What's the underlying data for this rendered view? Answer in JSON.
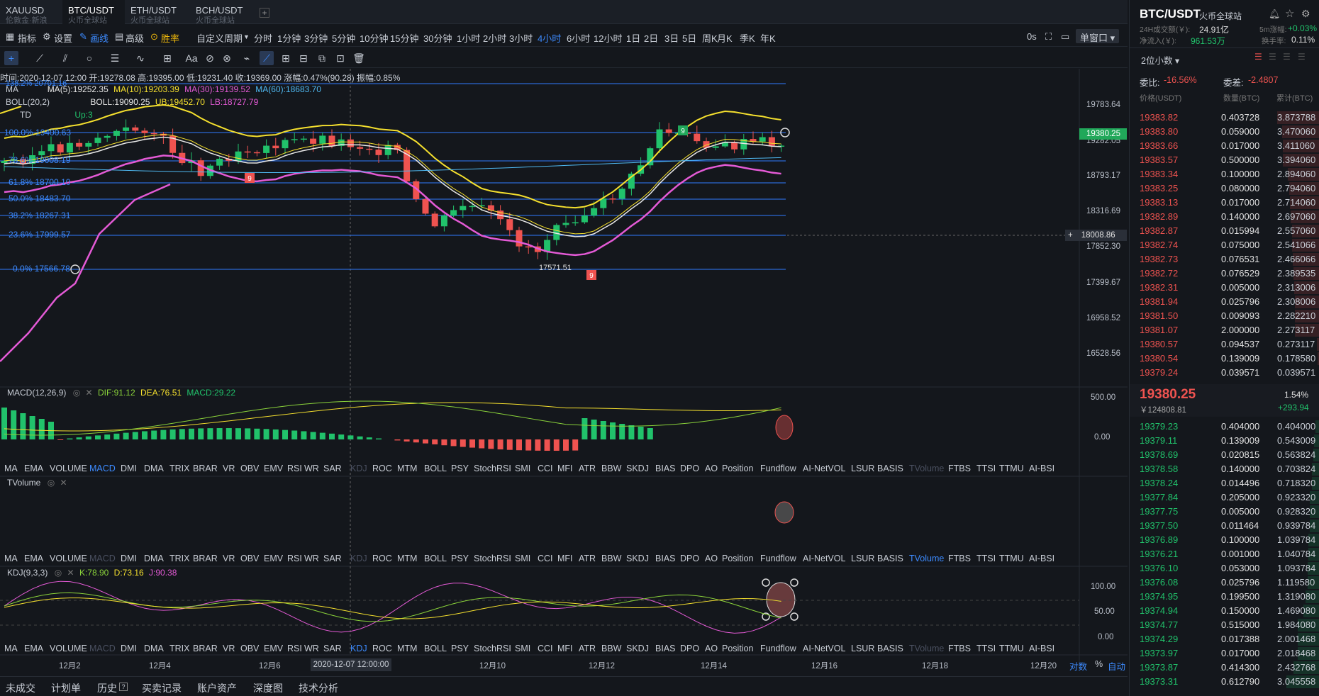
{
  "tabs": [
    {
      "t1": "XAUUSD",
      "t2": "伦敦金·新浪"
    },
    {
      "t1": "BTC/USDT",
      "t2": "火币全球站"
    },
    {
      "t1": "ETH/USDT",
      "t2": "火币全球站"
    },
    {
      "t1": "BCH/USDT",
      "t2": "火币全球站"
    }
  ],
  "add_tab": "+",
  "toolbar": {
    "indicators": "指标",
    "settings": "设置",
    "draw": "画线",
    "advanced": "高级",
    "win_rate": "胜率",
    "custom_period": "自定义周期",
    "periods": [
      "分时",
      "1分钟",
      "3分钟",
      "5分钟",
      "10分钟",
      "15分钟",
      "30分钟",
      "1小时",
      "2小时",
      "3小时",
      "4小时",
      "6小时",
      "12小时",
      "1日",
      "2日",
      "3日",
      "5日",
      "周K",
      "月K",
      "季K",
      "年K"
    ],
    "active_period": "4小时",
    "zero_s": "0s",
    "window": "单窗口"
  },
  "draw_tools": {
    "font": "Aa"
  },
  "info": {
    "line": "时间:2020-12-07 12:00 开:19278.08 高:19395.00 低:19231.40 收:19369.00 涨幅:0.47%(90.28) 振幅:0.85%",
    "ma": "MA",
    "ma5": "MA(5):19252.35",
    "ma10": "MA(10):19203.39",
    "ma30": "MA(30):19139.52",
    "ma60": "MA(60):18683.70",
    "boll": "BOLL(20,2)",
    "boll_mid": "BOLL:19090.25",
    "boll_ub": "UB:19452.70",
    "boll_lb": "LB:18727.79",
    "td": "TD",
    "td_up": "Up:3",
    "hidden_fib": "138.2% 20701.16"
  },
  "fib": [
    {
      "label": "100.0% 19400.63"
    },
    {
      "label": "78.6% 19008.19"
    },
    {
      "label": "61.8% 18700.10"
    },
    {
      "label": "50.0% 18483.70"
    },
    {
      "label": "38.2% 18267.31"
    },
    {
      "label": "23.6% 17999.57"
    },
    {
      "label": "0.0% 17566.78"
    }
  ],
  "price_axis": [
    "19783.64",
    "19282.05",
    "18793.17",
    "18316.69",
    "17852.30",
    "17399.67",
    "16958.52",
    "16528.56"
  ],
  "current_price_tag": "19380.25",
  "crosshair_price": "18008.86",
  "low_label": "17571.51",
  "td_marks": [
    "9",
    "9",
    "9"
  ],
  "macd": {
    "title": "MACD(12,26,9)",
    "dif": "DIF:91.12",
    "dea": "DEA:76.51",
    "macd": "MACD:29.22",
    "axis": [
      "500.00",
      "0.00"
    ]
  },
  "tvolume": {
    "title": "TVolume"
  },
  "kdj": {
    "title": "KDJ(9,3,3)",
    "k": "K:78.90",
    "d": "D:73.16",
    "j": "J:90.38",
    "axis": [
      "100.00",
      "50.00",
      "0.00"
    ]
  },
  "ind_list": [
    "MA",
    "EMA",
    "VOLUME",
    "MACD",
    "DMI",
    "DMA",
    "TRIX",
    "BRAR",
    "VR",
    "OBV",
    "EMV",
    "RSI",
    "WR",
    "SAR",
    "KDJ",
    "ROC",
    "MTM",
    "BOLL",
    "PSY",
    "StochRSI",
    "SMI",
    "CCI",
    "MFI",
    "ATR",
    "BBW",
    "SKDJ",
    "BIAS",
    "DPO",
    "AO",
    "Position",
    "Fundflow",
    "AI-NetVOL",
    "LSUR",
    "BASIS",
    "TVolume",
    "FTBS",
    "TTSI",
    "TTMU",
    "AI-BSI"
  ],
  "time_axis": [
    "12月2",
    "12月4",
    "12月6",
    "12月10",
    "12月12",
    "12月14",
    "12月16",
    "12月18",
    "12月20"
  ],
  "crosshair_time": "2020-12-07 12:00:00",
  "axis_opts": {
    "log": "对数",
    "pct": "%",
    "auto": "自动"
  },
  "bottom_tabs": [
    "未成交",
    "计划单",
    "历史",
    "买卖记录",
    "账户资产",
    "深度图",
    "技术分析"
  ],
  "right": {
    "symbol": "BTC/USDT",
    "exchange": "火币全球站",
    "vol_label": "24H成交额(￥):",
    "vol": "24.91亿",
    "rise_label": "5m涨幅:",
    "rise": "+0.03%",
    "inflow_label": "净流入(￥):",
    "inflow": "961.53万",
    "turnover_label": "换手率:",
    "turnover": "0.11%",
    "precision": "2位小数",
    "weibi_label": "委比:",
    "weibi": "-16.56%",
    "weicha_label": "委差:",
    "weicha": "-2.4807",
    "col_price": "价格(USDT)",
    "col_qty": "数量(BTC)",
    "col_total": "累计(BTC)",
    "last": "19380.25",
    "last_cny": "￥124808.81",
    "chg_pct": "1.54%",
    "chg": "+293.94"
  },
  "asks": [
    [
      "19383.82",
      "0.403728",
      "3.873788"
    ],
    [
      "19383.80",
      "0.059000",
      "3.470060"
    ],
    [
      "19383.66",
      "0.017000",
      "3.411060"
    ],
    [
      "19383.57",
      "0.500000",
      "3.394060"
    ],
    [
      "19383.34",
      "0.100000",
      "2.894060"
    ],
    [
      "19383.25",
      "0.080000",
      "2.794060"
    ],
    [
      "19383.13",
      "0.017000",
      "2.714060"
    ],
    [
      "19382.89",
      "0.140000",
      "2.697060"
    ],
    [
      "19382.87",
      "0.015994",
      "2.557060"
    ],
    [
      "19382.74",
      "0.075000",
      "2.541066"
    ],
    [
      "19382.73",
      "0.076531",
      "2.466066"
    ],
    [
      "19382.72",
      "0.076529",
      "2.389535"
    ],
    [
      "19382.31",
      "0.005000",
      "2.313006"
    ],
    [
      "19381.94",
      "0.025796",
      "2.308006"
    ],
    [
      "19381.50",
      "0.009093",
      "2.282210"
    ],
    [
      "19381.07",
      "2.000000",
      "2.273117"
    ],
    [
      "19380.57",
      "0.094537",
      "0.273117"
    ],
    [
      "19380.54",
      "0.139009",
      "0.178580"
    ],
    [
      "19379.24",
      "0.039571",
      "0.039571"
    ]
  ],
  "bids": [
    [
      "19379.23",
      "0.404000",
      "0.404000"
    ],
    [
      "19379.11",
      "0.139009",
      "0.543009"
    ],
    [
      "19378.69",
      "0.020815",
      "0.563824"
    ],
    [
      "19378.58",
      "0.140000",
      "0.703824"
    ],
    [
      "19378.24",
      "0.014496",
      "0.718320"
    ],
    [
      "19377.84",
      "0.205000",
      "0.923320"
    ],
    [
      "19377.75",
      "0.005000",
      "0.928320"
    ],
    [
      "19377.50",
      "0.011464",
      "0.939784"
    ],
    [
      "19376.89",
      "0.100000",
      "1.039784"
    ],
    [
      "19376.21",
      "0.001000",
      "1.040784"
    ],
    [
      "19376.10",
      "0.053000",
      "1.093784"
    ],
    [
      "19376.08",
      "0.025796",
      "1.119580"
    ],
    [
      "19374.95",
      "0.199500",
      "1.319080"
    ],
    [
      "19374.94",
      "0.150000",
      "1.469080"
    ],
    [
      "19374.77",
      "0.515000",
      "1.984080"
    ],
    [
      "19374.29",
      "0.017388",
      "2.001468"
    ],
    [
      "19373.97",
      "0.017000",
      "2.018468"
    ],
    [
      "19373.87",
      "0.414300",
      "2.432768"
    ],
    [
      "19373.31",
      "0.612790",
      "3.045558"
    ]
  ],
  "colors": {
    "up": "#21c26b",
    "down": "#ef5350",
    "accent": "#2f7bff",
    "bg": "#14171c"
  }
}
